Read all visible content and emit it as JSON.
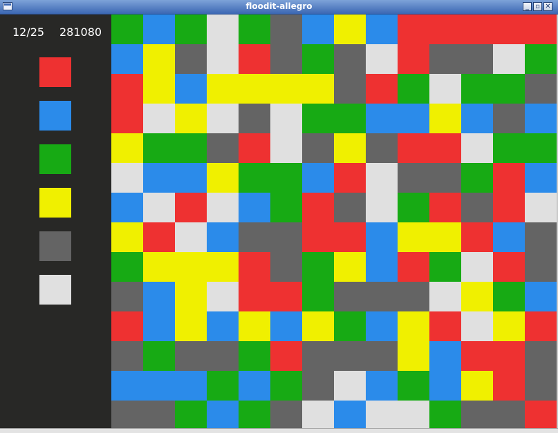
{
  "window": {
    "title": "floodit-allegro"
  },
  "window_buttons": {
    "minimize": "_",
    "maximize": "▫",
    "close": "✕"
  },
  "status": {
    "moves": "12/25",
    "score": "281080"
  },
  "palette": {
    "R": "#ee3131",
    "B": "#2b8bea",
    "G": "#17aa14",
    "Y": "#f0f000",
    "D": "#646464",
    "W": "#e0e0e0"
  },
  "color_buttons": [
    {
      "color": "R"
    },
    {
      "color": "B"
    },
    {
      "color": "G"
    },
    {
      "color": "Y"
    },
    {
      "color": "D"
    },
    {
      "color": "W"
    }
  ],
  "board": {
    "rows": [
      "GBGWGDBYBRRRRR",
      "BYDWRDGDWRDDWG",
      "RYBYYYYDRGWGGD",
      "RWYWDWGGBBYBDB",
      "YGGDRWDYDRRWGG",
      "WBBYGGBRWDDGRB",
      "BWRWBGRDWGRDRW",
      "YRWBDDRRBYYRBD",
      "GYYYRDGYBRGWRD",
      "DBYWRRGDDDWYGB",
      "RBYBYBYGBYRWYR",
      "DGDDGRDDDYBRRD",
      "BBBGBGDWBGBYRD",
      "DDGBGDWBWWGDDR"
    ]
  }
}
